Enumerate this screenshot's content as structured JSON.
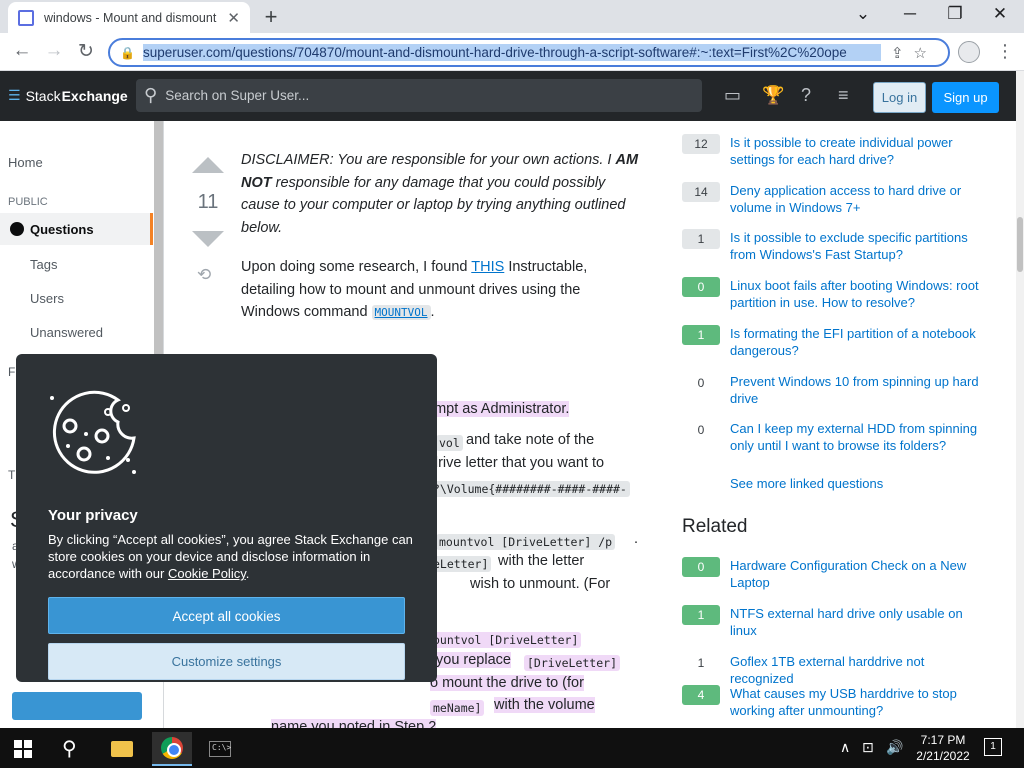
{
  "browser": {
    "tab_title": "windows - Mount and dismount",
    "new_tab": "+",
    "url": "superuser.com/questions/704870/mount-and-dismount-hard-drive-through-a-script-software#:~:text=First%2C%20ope"
  },
  "header": {
    "logo_prefix": "Stack",
    "logo_suffix": "Exchange",
    "search_placeholder": "Search on Super User...",
    "login": "Log in",
    "signup": "Sign up"
  },
  "leftnav": {
    "home": "Home",
    "public": "PUBLIC",
    "questions": "Questions",
    "tags": "Tags",
    "users": "Users",
    "unanswered": "Unanswered",
    "frag1": "FI",
    "frag2": "TI",
    "frag3": "S",
    "frag4": "a",
    "frag5": "w"
  },
  "post": {
    "votes": "11",
    "disclaimer_a": "DISCLAIMER: You are responsible for your own actions. I ",
    "disclaimer_b": "AM NOT",
    "disclaimer_c": " responsible for any damage that you could possibly cause to your computer or laptop by trying anything outlined below.",
    "research_a": "Upon doing some research, I found ",
    "research_link": "THIS",
    "research_b": " Instructable, detailing how to mount and unmount drives using the Windows command ",
    "research_code": "MOUNTVOL",
    "research_c": ".",
    "f1": "ompt as Administrator.",
    "f2": "vol",
    "f3": "and take note of the",
    "f4": "drive letter that you want to",
    "f5": "?\\Volume{########-####-####-",
    "f6": "mountvol  [DriveLetter] /p",
    "f7": ".",
    "f8": "eLetter]",
    "f9": "with the letter",
    "f10": "wish to unmount. (For",
    "f11": "ountvol [DriveLetter]",
    "f12": "you replace",
    "f13": "[DriveLetter]",
    "f14": "o mount the drive to (for",
    "f15": "meName]",
    "f16": "with the volume",
    "f17": "name you noted in Step 2"
  },
  "sidebar": {
    "linked": [
      {
        "score": "12",
        "answered": false,
        "title": "Is it possible to create individual power settings for each hard drive?"
      },
      {
        "score": "14",
        "answered": false,
        "title": "Deny application access to hard drive or volume in Windows 7+"
      },
      {
        "score": "1",
        "answered": false,
        "title": "Is it possible to exclude specific partitions from Windows's Fast Startup?"
      },
      {
        "score": "0",
        "answered": true,
        "title": "Linux boot fails after booting Windows: root partition in use. How to resolve?"
      },
      {
        "score": "1",
        "answered": true,
        "title": "Is formating the EFI partition of a notebook dangerous?"
      },
      {
        "score": "0",
        "answered": false,
        "title": "Prevent Windows 10 from spinning up hard drive"
      },
      {
        "score": "0",
        "answered": false,
        "title": "Can I keep my external HDD from spinning only until I want to browse its folders?"
      }
    ],
    "see_more": "See more linked questions",
    "related_title": "Related",
    "related": [
      {
        "score": "0",
        "answered": true,
        "title": "Hardware Configuration Check on a New Laptop"
      },
      {
        "score": "1",
        "answered": true,
        "title": "NTFS external hard drive only usable on linux"
      },
      {
        "score": "1",
        "answered": false,
        "title": "Goflex 1TB external harddrive not recognized"
      },
      {
        "score": "4",
        "answered": true,
        "title": "What causes my USB harddrive to stop working after unmounting?"
      }
    ]
  },
  "cookie": {
    "title": "Your privacy",
    "text_a": "By clicking “Accept all cookies”, you agree Stack Exchange can store cookies on your device and disclose information in accordance with our ",
    "policy_link": "Cookie Policy",
    "text_b": ".",
    "accept": "Accept all cookies",
    "customize": "Customize settings"
  },
  "taskbar": {
    "time": "7:17 PM",
    "date": "2/21/2022",
    "notifications": "1",
    "terminal_glyph": "C:\\>"
  },
  "colors": {
    "accent": "#0a95ff",
    "answered": "#5eba7d",
    "header_bg": "#232629",
    "cookie_bg": "#2d3236"
  }
}
